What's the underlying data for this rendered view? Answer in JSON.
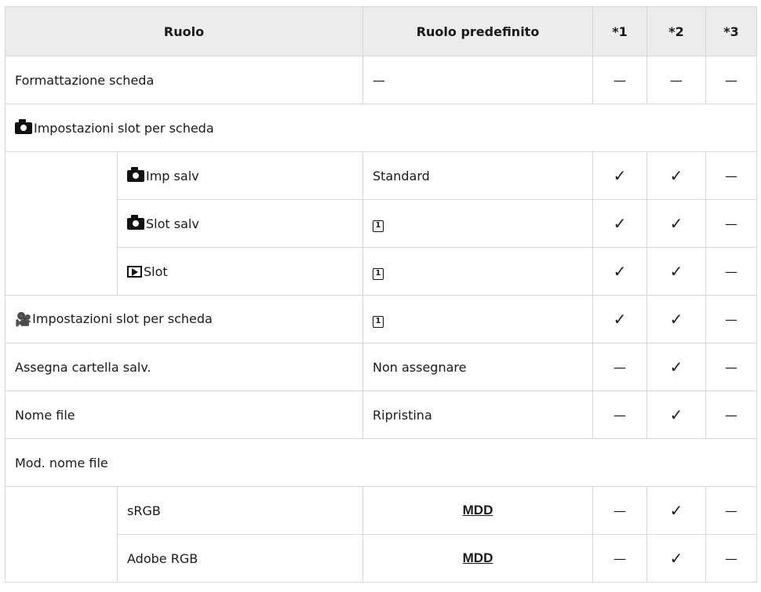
{
  "header": {
    "function": "Ruolo",
    "default": "Ruolo predefinito",
    "c1": "*1",
    "c2": "*2",
    "c3": "*3"
  },
  "marks": {
    "check": "✓",
    "dash": "—"
  },
  "rows": {
    "format": {
      "label": "Formattazione scheda",
      "default": "—"
    },
    "photo_slot": {
      "label": "Impostazioni slot per scheda"
    },
    "imp_salv": {
      "label": "Imp salv",
      "default": "Standard"
    },
    "slot_salv": {
      "label": "Slot salv",
      "default": "1"
    },
    "play_slot": {
      "label": "Slot",
      "default": "1"
    },
    "movie_slot": {
      "label": "Impostazioni slot per scheda",
      "default": "1"
    },
    "folder": {
      "label": "Assegna cartella salv.",
      "default": "Non assegnare"
    },
    "filename": {
      "label": "Nome file",
      "default": "Ripristina"
    },
    "edit_filename": {
      "label": "Mod. nome file"
    },
    "srgb": {
      "label": "sRGB",
      "default": "MDD"
    },
    "adobe": {
      "label": "Adobe RGB",
      "default": "MDD"
    }
  },
  "icons": {
    "camera": "camera-icon",
    "playback": "playback-icon",
    "movie": "movie-icon",
    "card_slot": "card-slot-1-icon"
  }
}
